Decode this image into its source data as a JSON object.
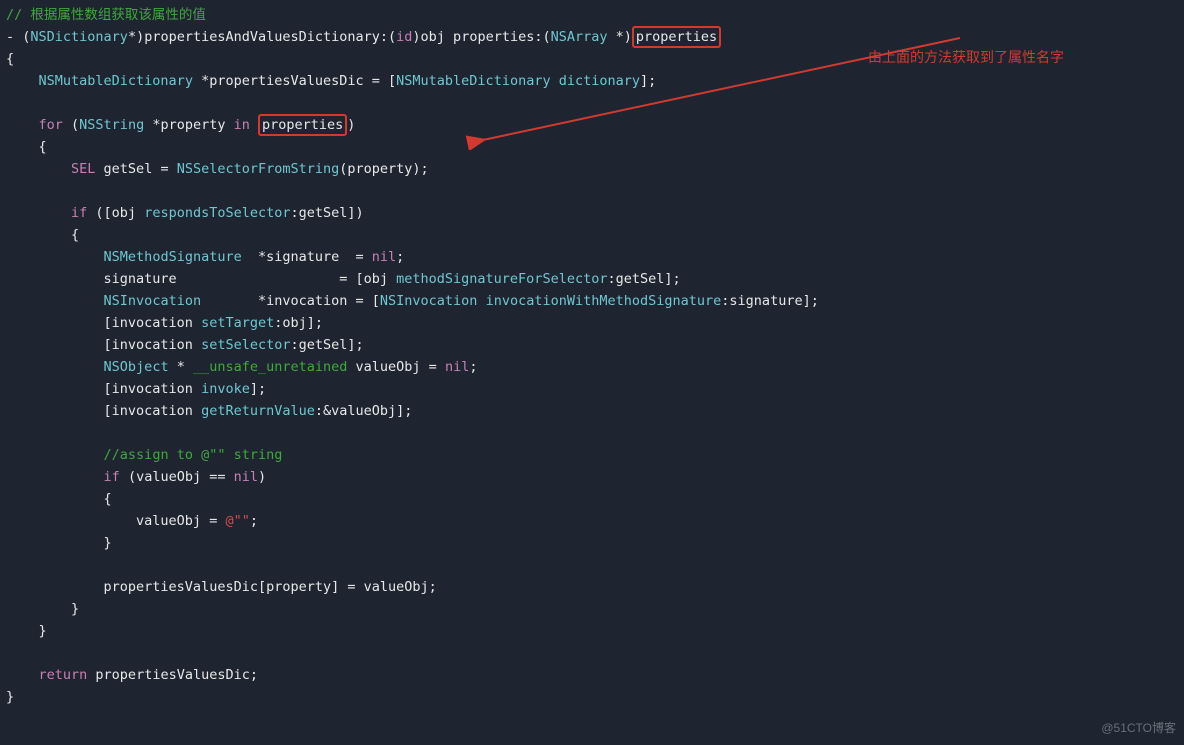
{
  "code": {
    "l1": "// 根据属性数组获取该属性的值",
    "l2a": "- (",
    "l2b": "NSDictionary",
    "l2c": "*)propertiesAndValuesDictionary:(",
    "l2d": "id",
    "l2e": ")obj properties:(",
    "l2f": "NSArray",
    "l2g": " *)",
    "l2h": "properties",
    "l3": "{",
    "l4a": "    ",
    "l4b": "NSMutableDictionary",
    "l4c": " *propertiesValuesDic = [",
    "l4d": "NSMutableDictionary",
    "l4e": " ",
    "l4f": "dictionary",
    "l4g": "];",
    "l5": "",
    "l6a": "    ",
    "l6b": "for",
    "l6c": " (",
    "l6d": "NSString",
    "l6e": " *property ",
    "l6f": "in",
    "l6g": " ",
    "l6h": "properties",
    "l6i": ")",
    "l7": "    {",
    "l8a": "        ",
    "l8b": "SEL",
    "l8c": " getSel = ",
    "l8d": "NSSelectorFromString",
    "l8e": "(property);",
    "l9": "",
    "l10a": "        ",
    "l10b": "if",
    "l10c": " ([obj ",
    "l10d": "respondsToSelector",
    "l10e": ":getSel])",
    "l11": "        {",
    "l12a": "            ",
    "l12b": "NSMethodSignature",
    "l12c": "  *signature  = ",
    "l12d": "nil",
    "l12e": ";",
    "l13a": "            signature                    = [obj ",
    "l13b": "methodSignatureForSelector",
    "l13c": ":getSel];",
    "l14a": "            ",
    "l14b": "NSInvocation",
    "l14c": "       *invocation = [",
    "l14d": "NSInvocation",
    "l14e": " ",
    "l14f": "invocationWithMethodSignature",
    "l14g": ":signature];",
    "l15a": "            [invocation ",
    "l15b": "setTarget",
    "l15c": ":obj];",
    "l16a": "            [invocation ",
    "l16b": "setSelector",
    "l16c": ":getSel];",
    "l17a": "            ",
    "l17b": "NSObject",
    "l17c": " * ",
    "l17d": "__unsafe_unretained",
    "l17e": " valueObj = ",
    "l17f": "nil",
    "l17g": ";",
    "l18a": "            [invocation ",
    "l18b": "invoke",
    "l18c": "];",
    "l19a": "            [invocation ",
    "l19b": "getReturnValue",
    "l19c": ":&valueObj];",
    "l20": "",
    "l21a": "            ",
    "l21b": "//assign to @\"\" string",
    "l22a": "            ",
    "l22b": "if",
    "l22c": " (valueObj == ",
    "l22d": "nil",
    "l22e": ")",
    "l23": "            {",
    "l24a": "                valueObj = ",
    "l24b": "@\"\"",
    "l24c": ";",
    "l25": "            }",
    "l26": "",
    "l27": "            propertiesValuesDic[property] = valueObj;",
    "l28": "        }",
    "l29": "    }",
    "l30": "",
    "l31a": "    ",
    "l31b": "return",
    "l31c": " propertiesValuesDic;",
    "l32": "}"
  },
  "annotation": "由上面的方法获取到了属性名字",
  "watermark": "@51CTO博客"
}
